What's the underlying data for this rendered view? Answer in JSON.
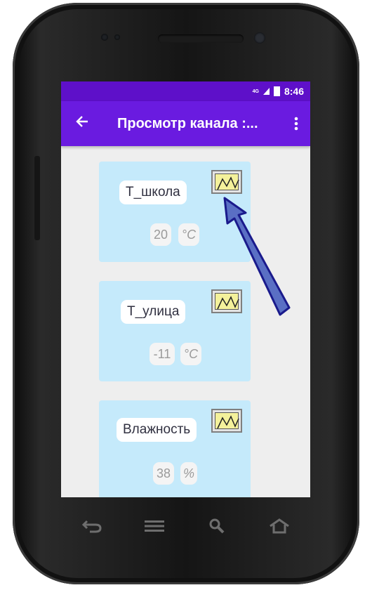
{
  "status_bar": {
    "network": "4G",
    "time": "8:46"
  },
  "app_bar": {
    "back_icon": "arrow-left-icon",
    "title": "Просмотр канала :...",
    "menu_icon": "more-vert-icon"
  },
  "channels": [
    {
      "name": "Т_школа",
      "value": "20",
      "unit": "°C"
    },
    {
      "name": "Т_улица",
      "value": "-11",
      "unit": "°C"
    },
    {
      "name": "Влажность",
      "value": "38",
      "unit": "%"
    }
  ],
  "chart_button_icon": "line-chart-icon",
  "nav_bar": {
    "icons": [
      "back-nav-icon",
      "menu-nav-icon",
      "search-nav-icon",
      "home-nav-icon"
    ]
  },
  "colors": {
    "status_bar": "#5e10c9",
    "app_bar": "#6a1be0",
    "card": "#c5eafb",
    "annotation_arrow": "#1a1a8c"
  }
}
